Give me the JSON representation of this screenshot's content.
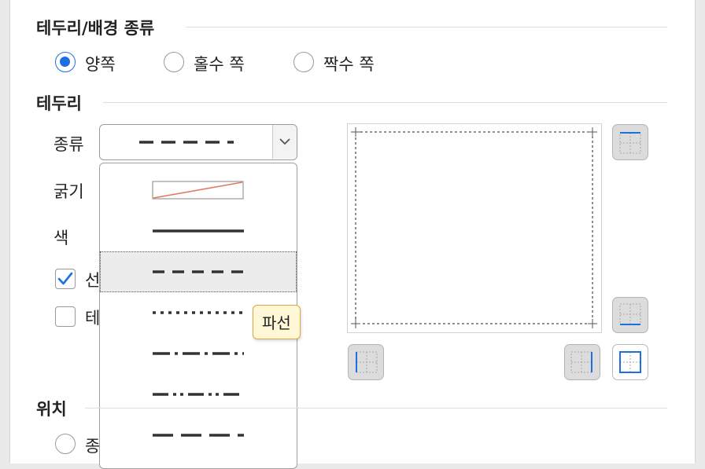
{
  "section_border_bg": {
    "title": "테두리/배경 종류",
    "options": [
      "양쪽",
      "홀수 쪽",
      "짝수 쪽"
    ],
    "selected": "양쪽"
  },
  "section_border": {
    "title": "테두리",
    "type_label": "종류",
    "thickness_label": "굵기",
    "color_label": "색",
    "checkbox1_label": "선",
    "checkbox1_checked": true,
    "checkbox2_label": "테",
    "checkbox2_checked": false,
    "combo_selected": "dashed",
    "line_styles": [
      "none",
      "solid",
      "dashed",
      "dotted",
      "dash-dot",
      "dash-dot-dot",
      "long-dash"
    ],
    "tooltip": "파선"
  },
  "section_position": {
    "title": "위치",
    "option1_label": "종"
  },
  "colors": {
    "accent": "#1f6fe0",
    "tooltip_bg": "#fff7d6",
    "tooltip_border": "#d9a74a",
    "selected_item_bg": "#ececec"
  },
  "icons": [
    "check-icon",
    "chevron-down-icon",
    "border-top-icon",
    "border-bottom-icon",
    "border-left-icon",
    "border-right-icon",
    "border-outside-icon"
  ]
}
